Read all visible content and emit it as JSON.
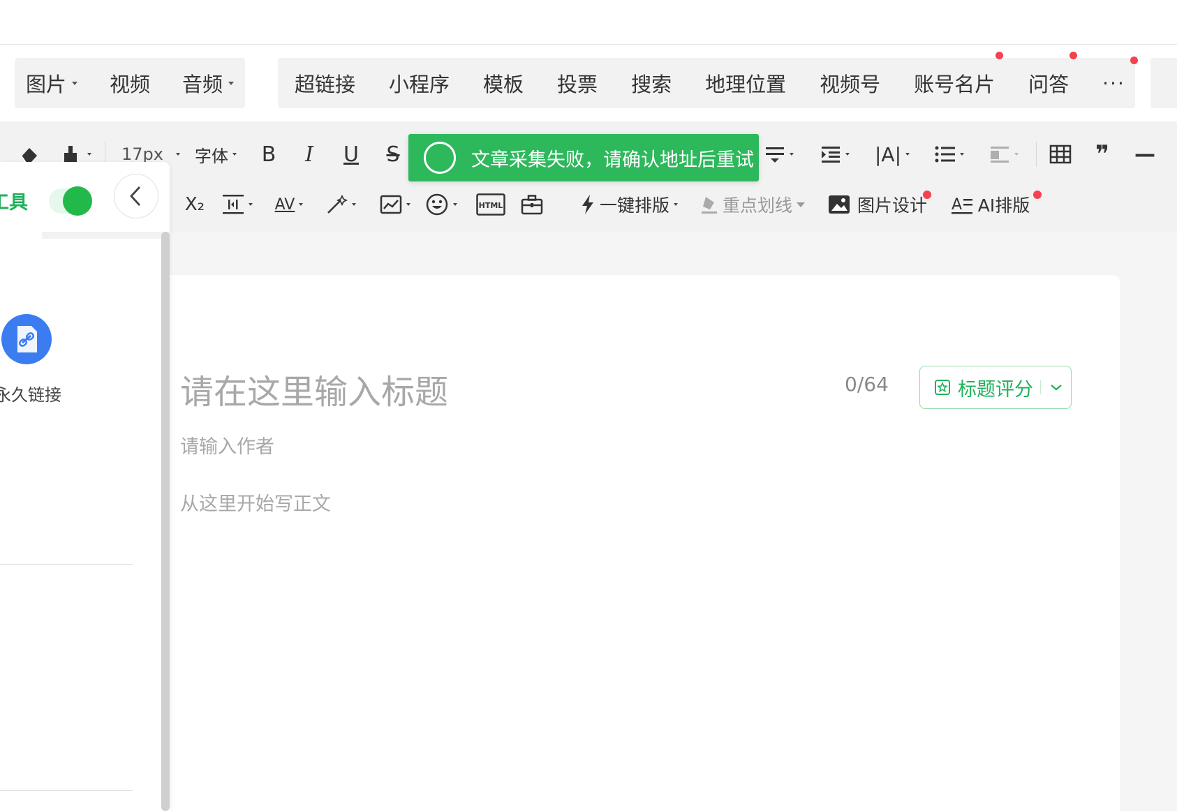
{
  "insert_bar": {
    "group1": [
      {
        "label": "图片",
        "dropdown": true
      },
      {
        "label": "视频",
        "dropdown": false
      },
      {
        "label": "音频",
        "dropdown": true
      }
    ],
    "group2": [
      {
        "label": "超链接",
        "badge": false
      },
      {
        "label": "小程序",
        "badge": false
      },
      {
        "label": "模板",
        "badge": false
      },
      {
        "label": "投票",
        "badge": false
      },
      {
        "label": "搜索",
        "badge": false
      },
      {
        "label": "地理位置",
        "badge": false
      },
      {
        "label": "视频号",
        "badge": false
      },
      {
        "label": "账号名片",
        "badge": true
      },
      {
        "label": "问答",
        "badge": true
      }
    ],
    "more_label": "···",
    "more_badge": true,
    "badge_color": "#f5424d"
  },
  "format_toolbar": {
    "font_size": "17px",
    "font_family": "字体",
    "bold": "B",
    "italic": "I",
    "underline": "U",
    "strikethrough": "S",
    "subscript": "X₂",
    "letter_spacing": "AV",
    "one_click_layout": "一键排版",
    "highlight_underline": "重点划线",
    "image_design": "图片设计",
    "ai_layout": "AI排版",
    "html_label": "HTML",
    "quote_glyph": "❞",
    "hr_glyph": "—"
  },
  "toast": {
    "message": "文章采集失败，请确认地址后重试",
    "background": "#2db85c"
  },
  "side_panel": {
    "title": "工具",
    "toggle_on": true,
    "accent": "#1fb15a",
    "tool_label": "永久链接",
    "tool_icon_color": "#3b7cf0"
  },
  "editor": {
    "title_placeholder": "请在这里输入标题",
    "title_count": "0/64",
    "title_score_label": "标题评分",
    "author_placeholder": "请输入作者",
    "body_placeholder": "从这里开始写正文"
  }
}
